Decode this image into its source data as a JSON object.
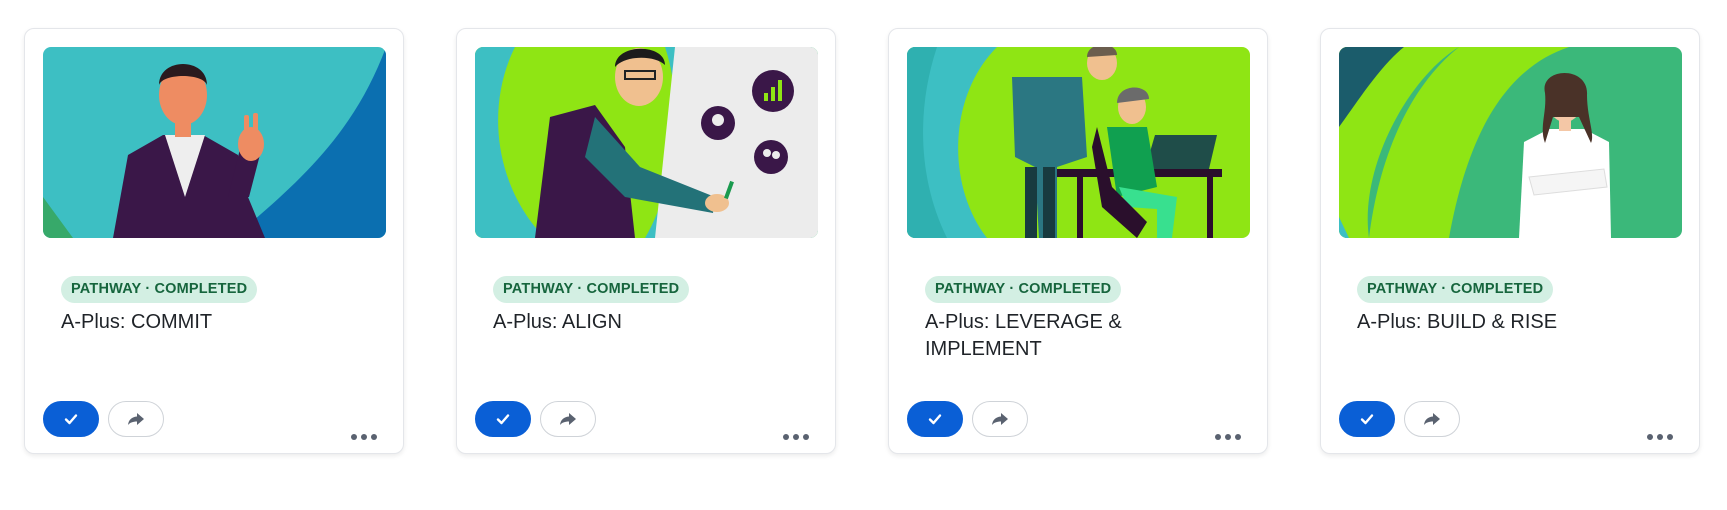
{
  "cards": [
    {
      "badge_type": "PATHWAY",
      "badge_sep": "·",
      "badge_status": "COMPLETED",
      "title": "A-Plus: COMMIT",
      "image_icon": "person-waving-illustration"
    },
    {
      "badge_type": "PATHWAY",
      "badge_sep": "·",
      "badge_status": "COMPLETED",
      "title": "A-Plus: ALIGN",
      "image_icon": "person-presenting-illustration"
    },
    {
      "badge_type": "PATHWAY",
      "badge_sep": "·",
      "badge_status": "COMPLETED",
      "title": "A-Plus: LEVERAGE & IMPLEMENT",
      "image_icon": "people-at-laptop-illustration"
    },
    {
      "badge_type": "PATHWAY",
      "badge_sep": "·",
      "badge_status": "COMPLETED",
      "title": "A-Plus: BUILD & RISE",
      "image_icon": "person-arms-crossed-illustration"
    }
  ],
  "icons": {
    "complete": "checkmark-icon",
    "share": "share-arrow-icon",
    "more": "more-dots-icon"
  },
  "colors": {
    "primary": "#0a5fd6",
    "badge_bg": "#d3efe3",
    "badge_text": "#16653d",
    "teal": "#3dbfc3",
    "lime": "#8fe514",
    "green": "#3bb87a",
    "purple": "#3a1748"
  }
}
